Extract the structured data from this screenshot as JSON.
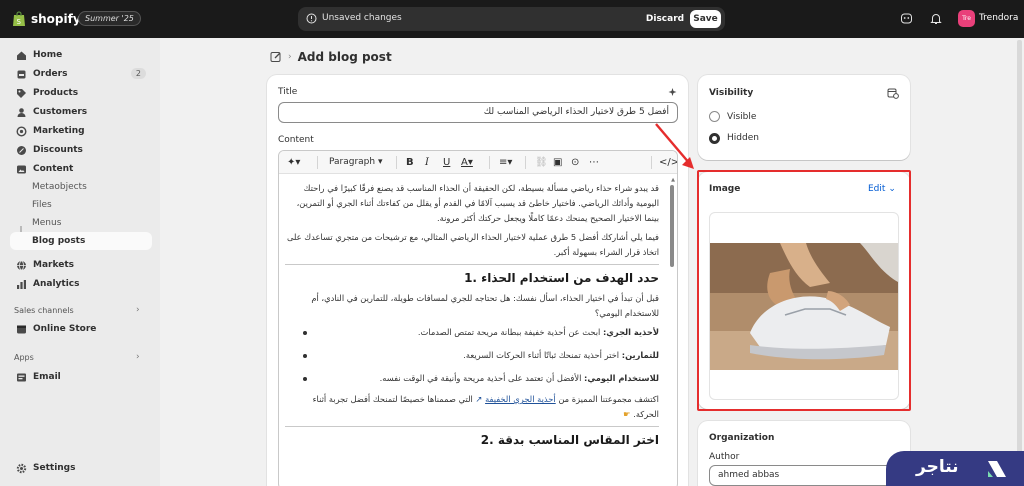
{
  "topbar": {
    "app": "shopify",
    "edition": "Summer '25",
    "unsaved": "Unsaved changes",
    "discard": "Discard",
    "save": "Save",
    "store_initials": "Tre",
    "store_name": "Trendora"
  },
  "sidebar": {
    "home": "Home",
    "orders": "Orders",
    "orders_count": "2",
    "products": "Products",
    "customers": "Customers",
    "marketing": "Marketing",
    "discounts": "Discounts",
    "content": "Content",
    "metaobjects": "Metaobjects",
    "files": "Files",
    "menus": "Menus",
    "blog_posts": "Blog posts",
    "markets": "Markets",
    "analytics": "Analytics",
    "sales_channels": "Sales channels",
    "online_store": "Online Store",
    "apps": "Apps",
    "email": "Email",
    "settings": "Settings"
  },
  "page": {
    "title": "Add blog post"
  },
  "post": {
    "title_label": "Title",
    "title_value": "أفضل 5 طرق لاختيار الحذاء الرياضي المناسب لك",
    "content_label": "Content",
    "paragraph_select": "Paragraph",
    "p1": "قد يبدو شراء حذاء رياضي مسألة بسيطة، لكن الحقيقة أن الحذاء المناسب قد يصنع فرقًا كبيرًا في راحتك اليومية وأدائك الرياضي. فاختيار خاطئ قد يسبب آلامًا في القدم أو يقلل من كفاءتك أثناء الجري أو التمرين، بينما الاختيار الصحيح يمنحك دعمًا كاملًا ويجعل حركتك أكثر مرونة.",
    "p2": "فيما يلي أشاركك أفضل 5 طرق عملية لاختيار الحذاء الرياضي المثالي، مع ترشيحات من متجري تساعدك على اتخاذ قرار الشراء بسهولة أكبر.",
    "h1": "حدد الهدف من استخدام الحذاء .1",
    "p3": "قبل أن تبدأ في اختيار الحذاء، اسأل نفسك: هل تحتاجه للجري لمسافات طويلة، للتمارين في النادي، أم للاستخدام اليومي؟",
    "b1_bold": "لأحذية الجري:",
    "b1": " ابحث عن أحذية خفيفة ببطانة مريحة تمتص الصدمات.",
    "b2_bold": "للتمارين:",
    "b2": " اختر أحذية تمنحك ثباتًا أثناء الحركات السريعة.",
    "b3_bold": "للاستخدام اليومي:",
    "b3": " الأفضل أن تعتمد على أحذية مريحة وأنيقة في الوقت نفسه.",
    "p4_a": "اكتشف مجموعتنا المميزة من ",
    "p4_link": "أحذية الجري الخفيفة",
    "p4_b": " التي صممناها خصيصًا لتمنحك أفضل تجربة أثناء الحركة.",
    "h2": "اختر المقاس المناسب بدقة .2"
  },
  "visibility": {
    "label": "Visibility",
    "visible": "Visible",
    "hidden": "Hidden",
    "selected": "Hidden"
  },
  "image": {
    "label": "Image",
    "edit": "Edit"
  },
  "organization": {
    "label": "Organization",
    "author_label": "Author",
    "author_value": "ahmed abbas"
  },
  "watermark": {
    "text": "نتاجر"
  },
  "colors": {
    "annotation": "#e52d2d",
    "brand": "#353a83",
    "store_avatar": "#e9407a"
  }
}
